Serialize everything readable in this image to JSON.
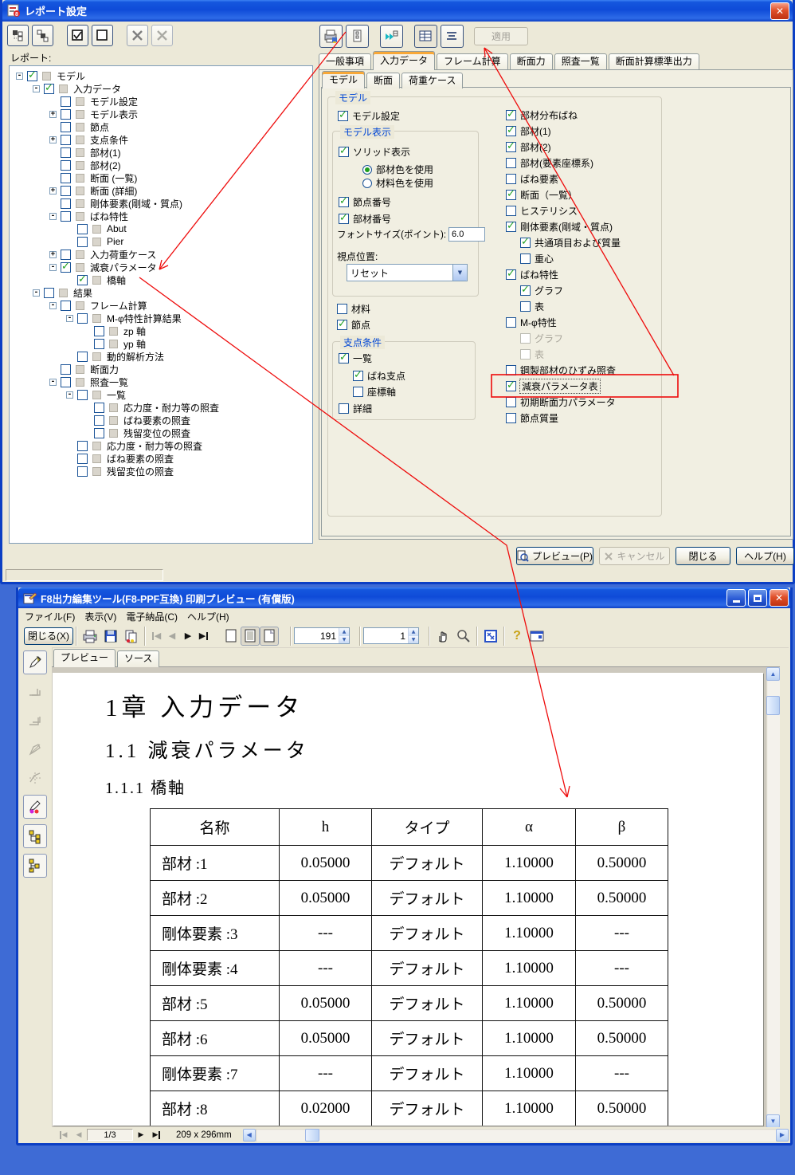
{
  "colors": {
    "titlebar_blue": "#0F4BD8",
    "window_bg": "#ECE9D8",
    "desktop_blue": "#3E6BD5",
    "tab_accent_orange": "#F8A838",
    "check_green": "#21A121",
    "annotation_red": "#FF0000",
    "groupbox_caption_blue": "#0046D5"
  },
  "dialog": {
    "title": "レポート設定",
    "title_icon": "report-app-icon",
    "toolbar_icons": [
      "expand-tree-icon",
      "collapse-tree-icon",
      "check-all-icon",
      "uncheck-all-icon",
      "delete-icon",
      "delete-all-icon"
    ],
    "tree_label": "レポート:",
    "tree_items": [
      {
        "label": "モデル",
        "lv": 0,
        "exp": "-",
        "chk": true
      },
      {
        "label": "入力データ",
        "lv": 1,
        "exp": "-",
        "chk": true
      },
      {
        "label": "モデル設定",
        "lv": 2,
        "exp": "",
        "chk": false
      },
      {
        "label": "モデル表示",
        "lv": 2,
        "exp": "+",
        "chk": false
      },
      {
        "label": "節点",
        "lv": 2,
        "exp": "",
        "chk": false
      },
      {
        "label": "支点条件",
        "lv": 2,
        "exp": "+",
        "chk": false
      },
      {
        "label": "部材(1)",
        "lv": 2,
        "exp": "",
        "chk": false
      },
      {
        "label": "部材(2)",
        "lv": 2,
        "exp": "",
        "chk": false
      },
      {
        "label": "断面 (一覧)",
        "lv": 2,
        "exp": "",
        "chk": false
      },
      {
        "label": "断面 (詳細)",
        "lv": 2,
        "exp": "+",
        "chk": false
      },
      {
        "label": "剛体要素(剛域・質点)",
        "lv": 2,
        "exp": "",
        "chk": false
      },
      {
        "label": "ばね特性",
        "lv": 2,
        "exp": "-",
        "chk": false
      },
      {
        "label": "Abut",
        "lv": 3,
        "exp": "",
        "chk": false
      },
      {
        "label": "Pier",
        "lv": 3,
        "exp": "",
        "chk": false
      },
      {
        "label": "入力荷重ケース",
        "lv": 2,
        "exp": "+",
        "chk": false
      },
      {
        "label": "減衰パラメータ",
        "lv": 2,
        "exp": "-",
        "chk": true
      },
      {
        "label": "橋軸",
        "lv": 3,
        "exp": "",
        "chk": true
      },
      {
        "label": "結果",
        "lv": 1,
        "exp": "-",
        "chk": false
      },
      {
        "label": "フレーム計算",
        "lv": 2,
        "exp": "-",
        "chk": false
      },
      {
        "label": "M-φ特性計算結果",
        "lv": 3,
        "exp": "-",
        "chk": false
      },
      {
        "label": "zp 軸",
        "lv": 4,
        "exp": "",
        "chk": false
      },
      {
        "label": "yp 軸",
        "lv": 4,
        "exp": "",
        "chk": false
      },
      {
        "label": "動的解析方法",
        "lv": 3,
        "exp": "",
        "chk": false
      },
      {
        "label": "断面力",
        "lv": 2,
        "exp": "",
        "chk": false
      },
      {
        "label": "照査一覧",
        "lv": 2,
        "exp": "-",
        "chk": false
      },
      {
        "label": "一覧",
        "lv": 3,
        "exp": "-",
        "chk": false
      },
      {
        "label": "応力度・耐力等の照査",
        "lv": 4,
        "exp": "",
        "chk": false
      },
      {
        "label": "ばね要素の照査",
        "lv": 4,
        "exp": "",
        "chk": false
      },
      {
        "label": "残留変位の照査",
        "lv": 4,
        "exp": "",
        "chk": false
      },
      {
        "label": "応力度・耐力等の照査",
        "lv": 3,
        "exp": "",
        "chk": false
      },
      {
        "label": "ばね要素の照査",
        "lv": 3,
        "exp": "",
        "chk": false
      },
      {
        "label": "残留変位の照査",
        "lv": 3,
        "exp": "",
        "chk": false
      }
    ],
    "right_toolbar_icons": [
      "print-preview-icon",
      "page-setup-icon",
      "export-grid-icon",
      "table-view-icon",
      "list-view-icon"
    ],
    "apply_label": "適用",
    "tabs": [
      "一般事項",
      "入力データ",
      "フレーム計算",
      "断面力",
      "照査一覧",
      "断面計算標準出力"
    ],
    "active_tab": "入力データ",
    "subtabs": [
      "モデル",
      "断面",
      "荷重ケース"
    ],
    "active_subtab": "モデル",
    "model_group": {
      "caption": "モデル",
      "model_setting": "モデル設定",
      "display_caption": "モデル表示",
      "solid": "ソリッド表示",
      "use_member_color": "部材色を使用",
      "use_material_color": "材料色を使用",
      "node_number": "節点番号",
      "member_number": "部材番号",
      "font_size_label": "フォントサイズ(ポイント):",
      "font_size_value": "6.0",
      "viewpoint_label": "視点位置:",
      "viewpoint_value": "リセット",
      "material": "材料",
      "node": "節点",
      "support_caption": "支点条件",
      "support_list": "一覧",
      "spring_support": "ばね支点",
      "coord_axis": "座標軸",
      "support_detail": "詳細",
      "right_items": [
        {
          "label": "部材分布ばね",
          "chk": true,
          "ind": false,
          "dis": false,
          "focus": false
        },
        {
          "label": "部材(1)",
          "chk": true,
          "ind": false,
          "dis": false,
          "focus": false
        },
        {
          "label": "部材(2)",
          "chk": true,
          "ind": false,
          "dis": false,
          "focus": false
        },
        {
          "label": "部材(要素座標系)",
          "chk": false,
          "ind": false,
          "dis": false,
          "focus": false
        },
        {
          "label": "ばね要素",
          "chk": false,
          "ind": false,
          "dis": false,
          "focus": false
        },
        {
          "label": "断面（一覧）",
          "chk": true,
          "ind": false,
          "dis": false,
          "focus": false
        },
        {
          "label": "ヒステリシス",
          "chk": false,
          "ind": false,
          "dis": false,
          "focus": false
        },
        {
          "label": "剛体要素(剛域・質点)",
          "chk": true,
          "ind": false,
          "dis": false,
          "focus": false
        },
        {
          "label": "共通項目および質量",
          "chk": true,
          "ind": true,
          "dis": false,
          "focus": false
        },
        {
          "label": "重心",
          "chk": false,
          "ind": true,
          "dis": false,
          "focus": false
        },
        {
          "label": "ばね特性",
          "chk": true,
          "ind": false,
          "dis": false,
          "focus": false
        },
        {
          "label": "グラフ",
          "chk": true,
          "ind": true,
          "dis": false,
          "focus": false
        },
        {
          "label": "表",
          "chk": false,
          "ind": true,
          "dis": false,
          "focus": false
        },
        {
          "label": "M-φ特性",
          "chk": false,
          "ind": false,
          "dis": false,
          "focus": false
        },
        {
          "label": "グラフ",
          "chk": false,
          "ind": true,
          "dis": true,
          "focus": false
        },
        {
          "label": "表",
          "chk": false,
          "ind": true,
          "dis": true,
          "focus": false
        },
        {
          "label": "鋼製部材のひずみ照査",
          "chk": false,
          "ind": false,
          "dis": false,
          "focus": false
        },
        {
          "label": "減衰パラメータ表",
          "chk": true,
          "ind": false,
          "dis": false,
          "focus": true
        },
        {
          "label": "初期断面力パラメータ",
          "chk": false,
          "ind": false,
          "dis": false,
          "focus": false
        },
        {
          "label": "節点質量",
          "chk": false,
          "ind": false,
          "dis": false,
          "focus": false
        }
      ]
    },
    "buttons": {
      "preview": "プレビュー(P)",
      "cancel": "キャンセル",
      "close": "閉じる",
      "help": "ヘルプ(H)"
    }
  },
  "preview_window": {
    "title": "F8出力編集ツール(F8-PPF互換) 印刷プレビュー (有償版)",
    "menus": [
      "ファイル(F)",
      "表示(V)",
      "電子納品(C)",
      "ヘルプ(H)"
    ],
    "toolbar": {
      "close_label": "閉じる(X)",
      "zoom_value": "191",
      "page_value": "1",
      "icons": [
        "printer-icon",
        "save-icon",
        "copy-page-icon",
        "first-page-icon",
        "prev-page-icon",
        "next-page-icon",
        "last-page-icon",
        "single-page-icon",
        "two-page-icon",
        "page-corner-icon",
        "hand-icon",
        "zoom-icon",
        "fit-page-icon",
        "help-icon",
        "about-icon"
      ]
    },
    "side_toolbar_icons": [
      "pen-icon",
      "layers-icon",
      "layers2-icon",
      "stamp-icon",
      "stamp2-icon",
      "edit-colors-icon",
      "tree-view-icon",
      "tree-view2-icon"
    ],
    "tabs": [
      "プレビュー",
      "ソース"
    ],
    "active_tab": "プレビュー",
    "document": {
      "heading1": "1章 入力データ",
      "heading2": "1.1 減衰パラメータ",
      "heading3": "1.1.1 橋軸",
      "table": {
        "headers": [
          "名称",
          "h",
          "タイプ",
          "α",
          "β"
        ],
        "rows": [
          [
            "部材 :1",
            "0.05000",
            "デフォルト",
            "1.10000",
            "0.50000"
          ],
          [
            "部材 :2",
            "0.05000",
            "デフォルト",
            "1.10000",
            "0.50000"
          ],
          [
            "剛体要素 :3",
            "---",
            "デフォルト",
            "1.10000",
            "---"
          ],
          [
            "剛体要素 :4",
            "---",
            "デフォルト",
            "1.10000",
            "---"
          ],
          [
            "部材 :5",
            "0.05000",
            "デフォルト",
            "1.10000",
            "0.50000"
          ],
          [
            "部材 :6",
            "0.05000",
            "デフォルト",
            "1.10000",
            "0.50000"
          ],
          [
            "剛体要素 :7",
            "---",
            "デフォルト",
            "1.10000",
            "---"
          ],
          [
            "部材 :8",
            "0.02000",
            "デフォルト",
            "1.10000",
            "0.50000"
          ]
        ]
      }
    },
    "statusbar": {
      "page_indicator": "1/3",
      "paper_size": "209 x 296mm"
    }
  },
  "annotation": {
    "highlighted_option": "減衰パラメータ表",
    "color": "#FF0000"
  }
}
